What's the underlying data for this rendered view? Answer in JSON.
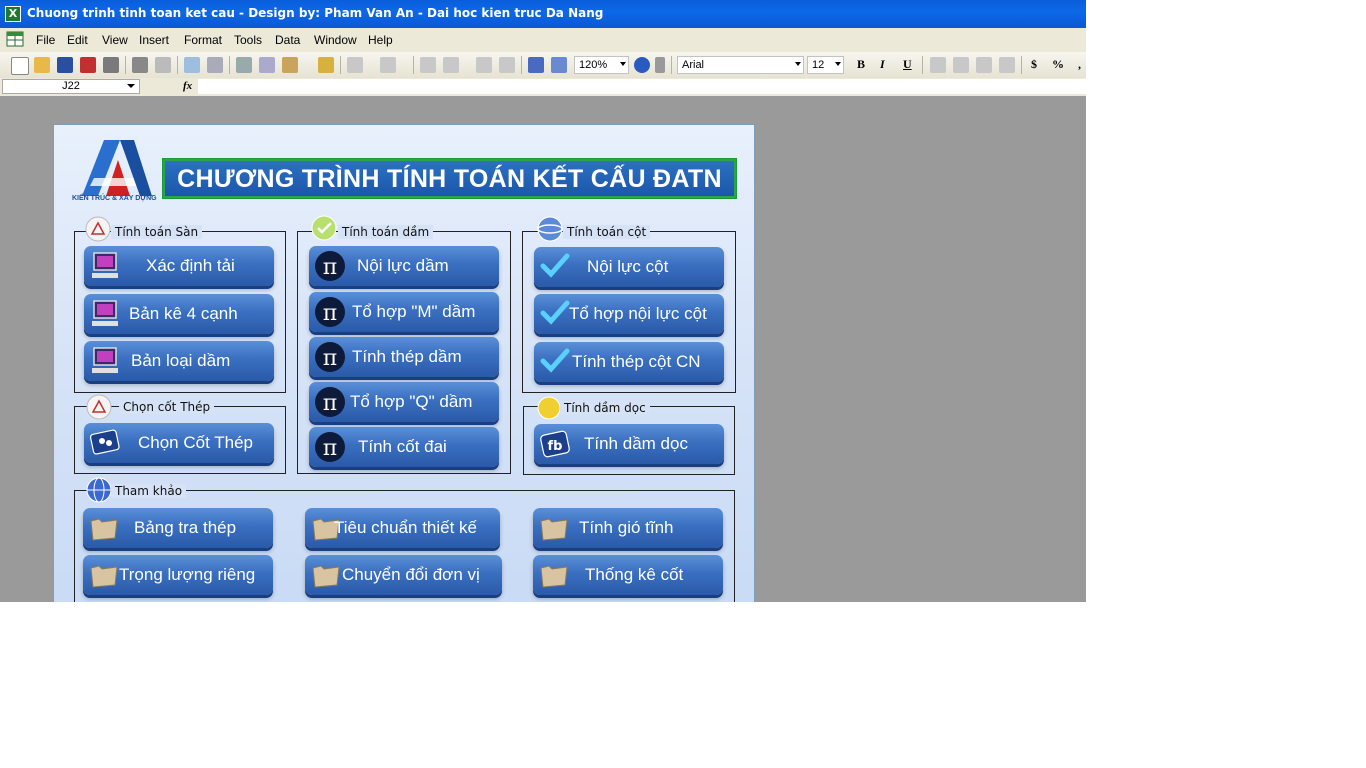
{
  "window": {
    "title": "Chuong trinh tinh toan ket cau - Design by: Pham Van An - Dai hoc kien truc Da Nang",
    "app_icon": "excel-icon"
  },
  "menubar": {
    "items": [
      "File",
      "Edit",
      "View",
      "Insert",
      "Format",
      "Tools",
      "Data",
      "Window",
      "Help"
    ]
  },
  "toolbar": {
    "zoom": "120%",
    "font_name": "Arial",
    "font_size": "12",
    "bold": "B",
    "italic": "I",
    "underline": "U",
    "currency": "$",
    "percent": "%",
    "comma": ","
  },
  "formula_bar": {
    "name_box": "J22",
    "fx_label": "fx"
  },
  "panel": {
    "logo_caption": "KIẾN TRÚC & XÂY DỰNG",
    "title": "CHƯƠNG TRÌNH TÍNH TOÁN KẾT CẤU ĐATN",
    "groups": {
      "san": "Tính toán Sàn",
      "dam": "Tính toán dầm",
      "cot": "Tính toán cột",
      "cot_thep": "Chọn cốt Thép",
      "dam_doc": "Tính dầm dọc",
      "tham_khao": "Tham khảo"
    },
    "buttons": {
      "xac_dinh_tai": "Xác định tải",
      "ban_ke": "Bản kê 4 cạnh",
      "ban_loai_dam": "Bản loại dầm",
      "noi_luc_dam": "Nội lực dầm",
      "to_hop_m": "Tổ hợp \"M\" dầm",
      "tinh_thep_dam": "Tính thép dầm",
      "to_hop_q": "Tổ hợp \"Q\" dầm",
      "tinh_cot_dai": "Tính cốt đai",
      "noi_luc_cot": "Nội lực cột",
      "to_hop_noi_luc_cot": "Tổ hợp nội lực cột",
      "tinh_thep_cot": "Tính thép cột CN",
      "chon_cot_thep": "Chọn Cốt Thép",
      "tinh_dam_doc": "Tính dầm dọc",
      "bang_tra_thep": "Bảng tra thép",
      "tieu_chuan": "Tiêu chuẩn thiết kế",
      "tinh_gio": "Tính gió tĩnh",
      "trong_luong": "Trọng lượng riêng",
      "chuyen_doi": "Chuyển đổi đơn vị",
      "thong_ke": "Thống kê cốt"
    }
  },
  "colors": {
    "titlebar": "#0a5ddb",
    "button": "#3a6fc0",
    "panel_bg": "#d6e3f7",
    "title_border": "#1a9a3a"
  }
}
